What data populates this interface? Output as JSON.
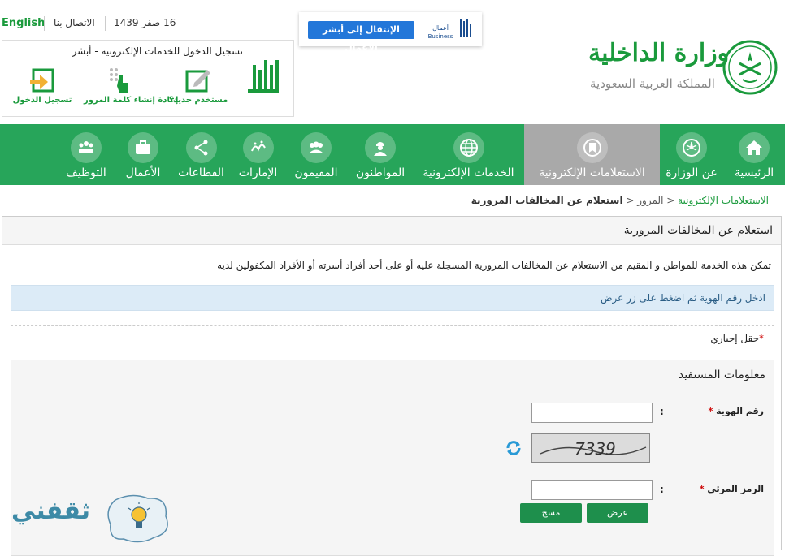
{
  "topbar": {
    "language_link": "English",
    "contact": "الاتصال بنا",
    "date": "16 صفر 1439"
  },
  "business": {
    "button_label": "الإنتقال إلى أبشر الأعمال",
    "logo_ar": "أعمال",
    "logo_en": "Business"
  },
  "login": {
    "title": "تسجيل الدخول للخدمات الإلكترونية - أبشر",
    "absher_logo": "أبشر",
    "buttons": [
      {
        "label": "مستخدم جديد؟",
        "icon": "new-user-icon"
      },
      {
        "label": "إعادة إنشاء كلمة المرور",
        "icon": "reset-password-icon"
      },
      {
        "label": "تسجيل الدخول",
        "icon": "login-icon"
      }
    ]
  },
  "ministry": {
    "name": "وزارة الداخلية",
    "subtitle": "المملكة العربية السعودية"
  },
  "nav": {
    "items": [
      {
        "label": "الرئيسية",
        "icon": "home-icon"
      },
      {
        "label": "عن الوزارة",
        "icon": "emblem-icon"
      },
      {
        "label": "الاستعلامات الإلكترونية",
        "icon": "inquiries-icon"
      },
      {
        "label": "الخدمات الإلكترونية",
        "icon": "globe-icon"
      },
      {
        "label": "المواطنون",
        "icon": "citizen-icon"
      },
      {
        "label": "المقيمون",
        "icon": "residents-icon"
      },
      {
        "label": "الإمارات",
        "icon": "emirates-icon"
      },
      {
        "label": "القطاعات",
        "icon": "sectors-icon"
      },
      {
        "label": "الأعمال",
        "icon": "briefcase-icon"
      },
      {
        "label": "التوظيف",
        "icon": "employment-icon"
      }
    ],
    "active_index": 2
  },
  "breadcrumb": {
    "items": [
      "الاستعلامات الإلكترونية",
      "المرور"
    ],
    "current": "استعلام عن المخالفات المرورية"
  },
  "panel": {
    "title": "استعلام عن المخالفات المرورية",
    "description": "تمكن هذه الخدمة للمواطن و المقيم من الاستعلام عن المخالفات المرورية المسجلة عليه أو على أحد أفراد أسرته أو الأفراد المكفولين لديه",
    "hint": "ادخل رقم الهوية ثم اضغط على زر عرض",
    "required_note": "حقل إجباري",
    "required_star": "*",
    "section_title": "معلومات المستفيد",
    "fields": {
      "id_label": "رقم الهوية",
      "id_value": "",
      "captcha_text": "7339",
      "code_label": "الرمز المرئي",
      "code_value": ""
    },
    "buttons": {
      "view": "عرض",
      "clear": "مسح"
    }
  },
  "watermark": {
    "text": "ثقفني"
  },
  "colors": {
    "green": "#27a55a",
    "active_nav": "#a9a9a9",
    "link_green": "#1a9a3c",
    "button_blue": "#2377d9"
  }
}
